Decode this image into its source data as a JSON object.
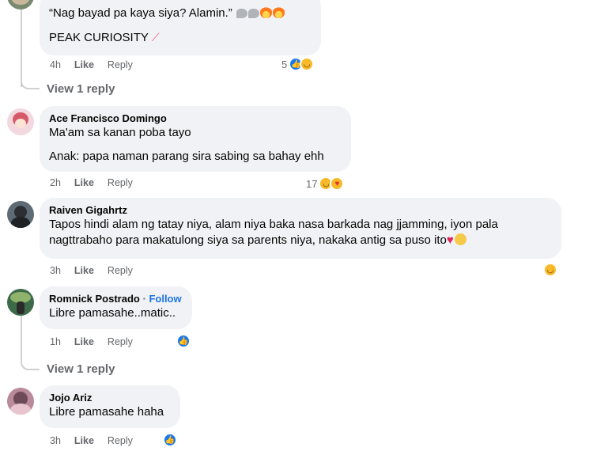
{
  "comments": [
    {
      "lines": [
        "“Nag bayad pa kaya siya? Alamin.”",
        "PEAK CURIOSITY"
      ],
      "time": "4h",
      "like": "Like",
      "reply": "Reply",
      "reaction_count": "5"
    },
    {
      "author": "Ace Francisco Domingo",
      "lines": [
        "Ma'am sa kanan poba tayo",
        "Anak: papa naman parang sira sabing sa bahay ehh"
      ],
      "time": "2h",
      "like": "Like",
      "reply": "Reply",
      "reaction_count": "17"
    },
    {
      "author": "Raiven Gigahrtz",
      "lines": [
        "Tapos hindi alam ng tatay niya, alam niya baka nasa barkada nag jjamming, iyon pala",
        "nagttrabaho para makatulong siya sa parents niya, nakaka antig sa puso ito"
      ],
      "time": "3h",
      "like": "Like",
      "reply": "Reply"
    },
    {
      "author": "Romnick Postrado",
      "follow": "Follow",
      "lines": [
        "Libre pamasahe..matic.."
      ],
      "time": "1h",
      "like": "Like",
      "reply": "Reply"
    },
    {
      "author": "Jojo Ariz",
      "lines": [
        "Libre pamasahe haha"
      ],
      "time": "3h",
      "like": "Like",
      "reply": "Reply"
    }
  ],
  "view_replies": [
    "View 1 reply",
    "View 1 reply"
  ],
  "icons": [
    "like-reaction-icon",
    "haha-reaction-icon",
    "love-reaction-icon",
    "care-reaction-icon",
    "fire-emoji-icon",
    "speech-emoji-icon",
    "heart-emoji-icon",
    "sad-emoji-icon",
    "trending-icon"
  ],
  "colors": {
    "bubble": "#f0f2f5",
    "meta": "#65676b",
    "link": "#1b74e4",
    "like": "#1877f2"
  }
}
